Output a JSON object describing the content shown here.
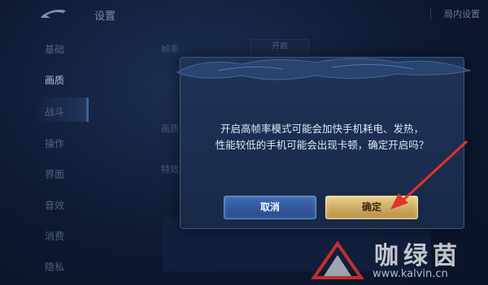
{
  "header": {
    "title": "设置",
    "right_tab": "局内设置"
  },
  "sidebar": {
    "items": [
      {
        "label": "基础"
      },
      {
        "label": "画质"
      },
      {
        "label": "战斗"
      },
      {
        "label": "操作"
      },
      {
        "label": "界面"
      },
      {
        "label": "音效"
      },
      {
        "label": "消费"
      },
      {
        "label": "隐私"
      }
    ],
    "active_index": 1
  },
  "background": {
    "labels": [
      "帧率",
      "画质",
      "特效"
    ],
    "toggle": "开启"
  },
  "dialog": {
    "message_lines": [
      "开启高帧率模式可能会加快手机耗电、发热，",
      "性能较低的手机可能会出现卡顿，确定开启吗？"
    ],
    "cancel_label": "取消",
    "confirm_label": "确定"
  },
  "watermark": {
    "text": "咖绿茵",
    "url": "www.kalvin.cn"
  },
  "colors": {
    "cancel": "#2f5596",
    "confirm": "#d2b06a",
    "arrow": "#e3322b"
  }
}
